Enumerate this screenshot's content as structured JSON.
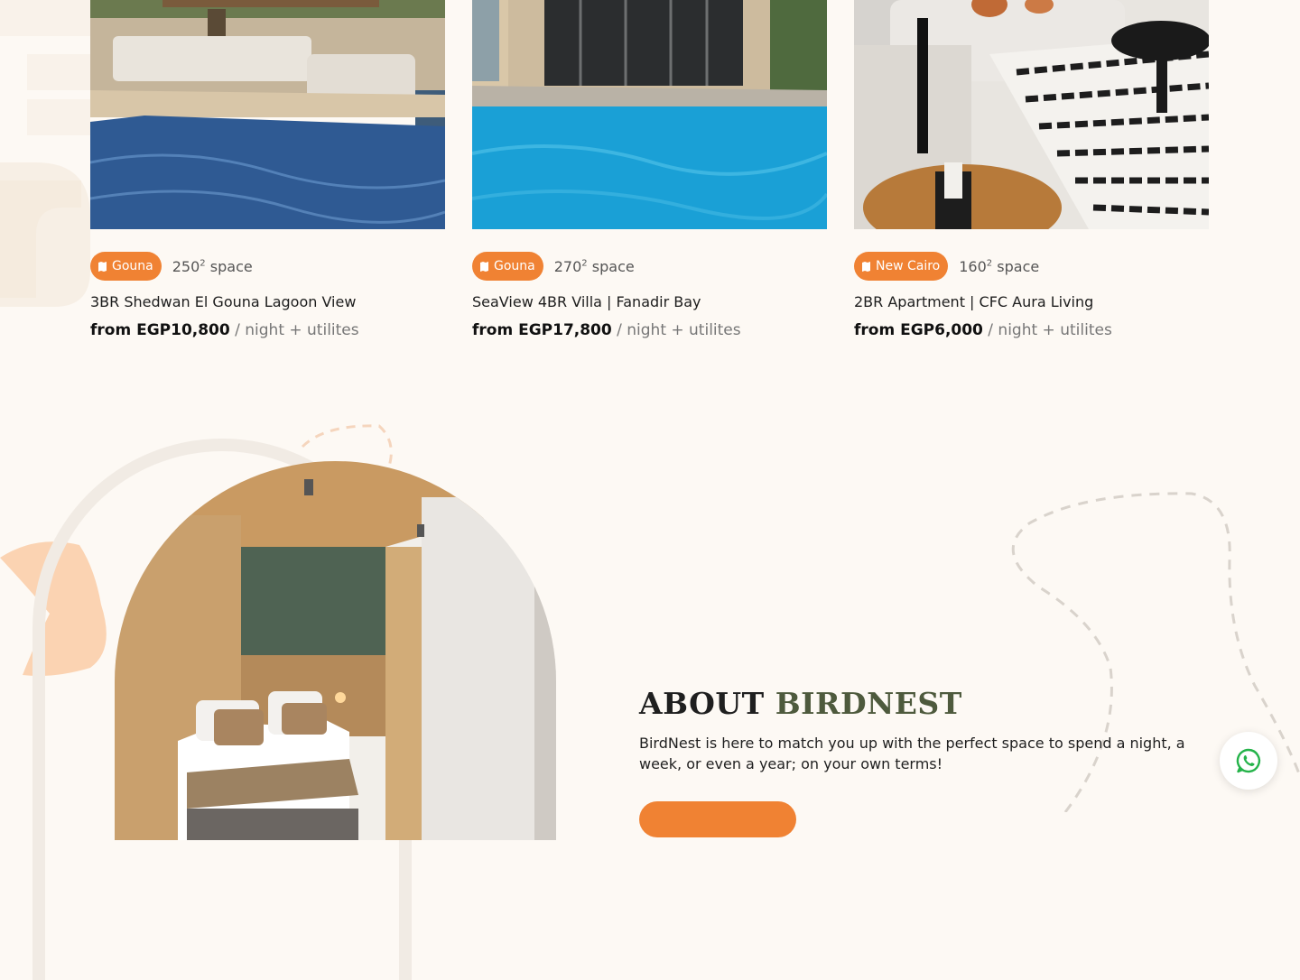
{
  "listings": [
    {
      "location": "Gouna",
      "space_value": "250",
      "space_sup": "2",
      "space_label": "space",
      "title": "3BR Shedwan El Gouna Lagoon View",
      "price": "from EGP10,800",
      "per": "/ night + utilites"
    },
    {
      "location": "Gouna",
      "space_value": "270",
      "space_sup": "2",
      "space_label": "space",
      "title": "SeaView 4BR Villa | Fanadir Bay",
      "price": "from EGP17,800",
      "per": "/ night + utilites"
    },
    {
      "location": "New Cairo",
      "space_value": "160",
      "space_sup": "2",
      "space_label": "space",
      "title": "2BR Apartment | CFC Aura Living",
      "price": "from EGP6,000",
      "per": "/ night + utilites"
    }
  ],
  "about": {
    "title_part1": "ABOUT",
    "title_part2": "BIRDNEST",
    "text": "BirdNest is here to match you up with the perfect space to spend a night, a week, or even a year; on your own terms!"
  },
  "colors": {
    "accent": "#f08233",
    "title_green": "#4e5a3d",
    "background": "#fdf9f4"
  },
  "icons": {
    "badge": "map-pin-icon",
    "floating": "whatsapp-icon"
  }
}
